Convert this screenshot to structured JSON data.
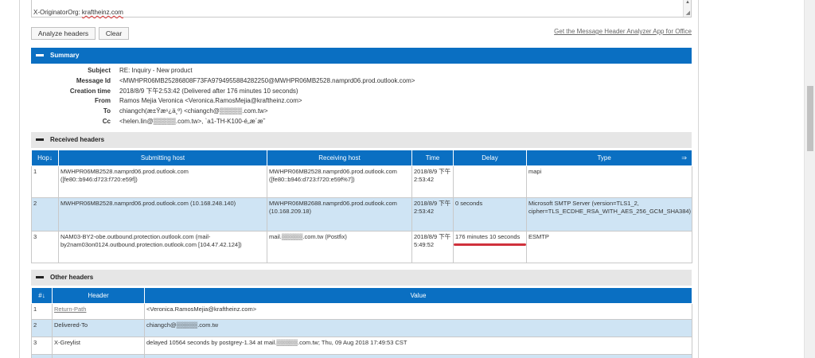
{
  "input": {
    "last_line_prefix": "X-OriginatorOrg: ",
    "last_line_org": "kraftheinz.com"
  },
  "buttons": {
    "analyze": "Analyze headers",
    "clear": "Clear"
  },
  "get_app_link": "Get the Message Header Analyzer App for Office",
  "summary": {
    "title": "Summary",
    "rows": [
      {
        "label": "Subject",
        "value": "RE: Inquiry - New product"
      },
      {
        "label": "Message Id",
        "value": "<MWHPR06MB25286808F73FA9794955884282250@MWHPR06MB2528.namprd06.prod.outlook.com>"
      },
      {
        "label": "Creation time",
        "value": "2018/8/9 下午2:53:42 (Delivered after 176 minutes 10 seconds)"
      },
      {
        "label": "From",
        "value": "Ramos Mejia Veronica <Veronica.RamosMejia@kraftheinz.com>"
      },
      {
        "label": "To",
        "value": "chiangch(æ±Ÿæ¹¿ä¸º) <chiangch@▒▒▒▒▒.com.tw>"
      },
      {
        "label": "Cc",
        "value": "<helen.lin@▒▒▒▒▒.com.tw>, `a1-TH-K100-é„æ´æ˜"
      }
    ]
  },
  "received": {
    "title": "Received headers",
    "columns": [
      "Hop↓",
      "Submitting host",
      "Receiving host",
      "Time",
      "Delay",
      "Type"
    ],
    "type_arrow": "⇒",
    "rows": [
      {
        "hop": "1",
        "submitting": "MWHPR06MB2528.namprd06.prod.outlook.com ([fe80::b946:d723:f720:e59f])",
        "receiving": "MWHPR06MB2528.namprd06.prod.outlook.com ([fe80::b946:d723:f720:e59f%7])",
        "time": "2018/8/9 下午 2:53:42",
        "delay": "",
        "type": "mapi"
      },
      {
        "hop": "2",
        "submitting": "MWHPR06MB2528.namprd06.prod.outlook.com (10.168.248.140)",
        "receiving": "MWHPR06MB2688.namprd06.prod.outlook.com (10.168.209.18)",
        "time": "2018/8/9 下午 2:53:42",
        "delay": "0 seconds",
        "type": "Microsoft SMTP Server (version=TLS1_2, cipher=TLS_ECDHE_RSA_WITH_AES_256_GCM_SHA384)"
      },
      {
        "hop": "3",
        "submitting": "NAM03-BY2-obe.outbound.protection.outlook.com (mail-by2nam03on0124.outbound.protection.outlook.com [104.47.42.124])",
        "receiving": "mail.▒▒▒▒▒.com.tw (Postfix)",
        "time": "2018/8/9 下午 5:49:52",
        "delay": "176 minutes 10 seconds",
        "type": "ESMTP"
      }
    ]
  },
  "other": {
    "title": "Other headers",
    "columns": [
      "#↓",
      "Header",
      "Value"
    ],
    "rows": [
      {
        "num": "1",
        "header": "Return-Path",
        "value": "<Veronica.RamosMejia@kraftheinz.com>"
      },
      {
        "num": "2",
        "header": "Delivered-To",
        "value": "chiangch@▒▒▒▒▒.com.tw"
      },
      {
        "num": "3",
        "header": "X-Greylist",
        "value": "delayed 10564 seconds by postgrey-1.34 at mail.▒▒▒▒▒.com.tw; Thu, 09 Aug 2018 17:49:53 CST"
      }
    ]
  },
  "colors": {
    "accent": "#0a6fc2",
    "alt_row": "#cfe4f4",
    "highlight": "#d0313c"
  },
  "icons": {
    "collapse": "minus-icon",
    "scroll_up": "triangle-up-icon",
    "resize": "resize-grip-icon"
  }
}
